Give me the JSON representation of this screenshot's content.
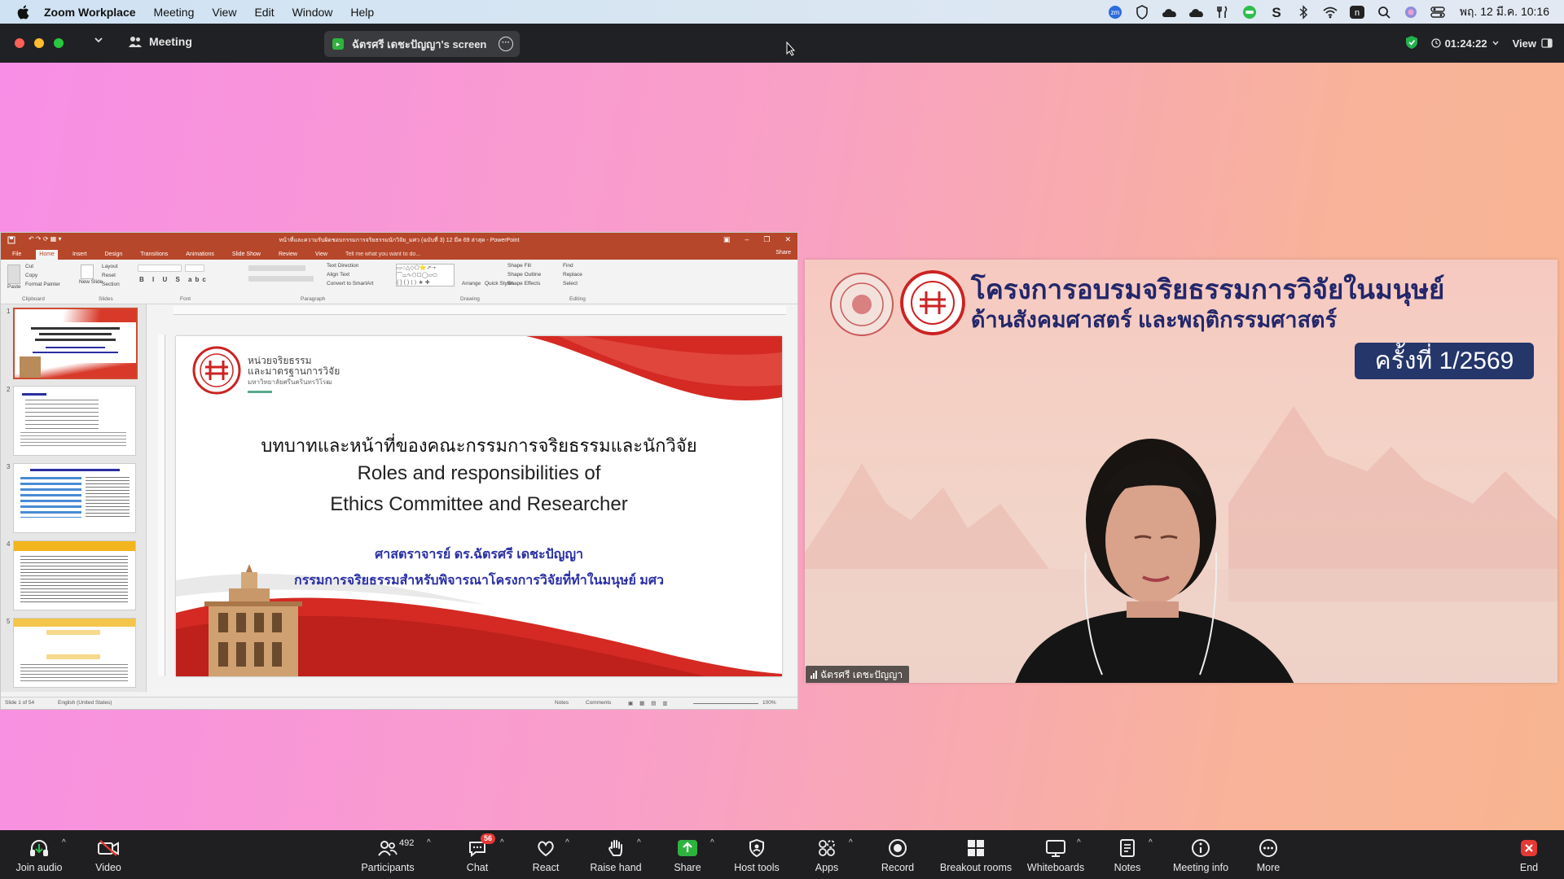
{
  "menubar": {
    "app_name": "Zoom Workplace",
    "menus": [
      "Meeting",
      "View",
      "Edit",
      "Window",
      "Help"
    ],
    "clock": "พฤ. 12 มี.ค.  10:16"
  },
  "zoom_header": {
    "meeting_label": "Meeting",
    "shared_screen_label": "ฉัตรศรี เดชะปัญญา's screen",
    "timer": "01:24:22",
    "view_label": "View"
  },
  "powerpoint": {
    "window_title": "หน้าที่และความรับผิดชอบกรรมการจริยธรรมนักวิจัย_มศว (ฉบับที่ 3) 12 มีค 69 ล่าสุด - PowerPoint",
    "tabs": [
      "File",
      "Home",
      "Insert",
      "Design",
      "Transitions",
      "Animations",
      "Slide Show",
      "Review",
      "View"
    ],
    "active_tab": "Home",
    "tell_me": "Tell me what you want to do...",
    "share_label": "Share",
    "ribbon_groups": [
      "Clipboard",
      "Slides",
      "Font",
      "Paragraph",
      "Drawing",
      "Editing"
    ],
    "ribbon_items": {
      "cut": "Cut",
      "copy": "Copy",
      "format_painter": "Format Painter",
      "paste": "Paste",
      "new_slide": "New Slide",
      "layout": "Layout",
      "reset": "Reset",
      "section": "Section",
      "text_direction": "Text Direction",
      "align_text": "Align Text",
      "convert_smartart": "Convert to SmartArt",
      "arrange": "Arrange",
      "quick_styles": "Quick Styles",
      "shape_fill": "Shape Fill",
      "shape_outline": "Shape Outline",
      "shape_effects": "Shape Effects",
      "find": "Find",
      "replace": "Replace",
      "select": "Select"
    },
    "thumbnail_numbers": [
      "1",
      "2",
      "3",
      "4",
      "5"
    ],
    "slide": {
      "logo_line1": "หน่วยจริยธรรม",
      "logo_line2": "และมาตรฐานการวิจัย",
      "logo_line3": "มหาวิทยาลัยศรีนครินทรวิโรฒ",
      "heading_thai": "บทบาทและหน้าที่ของคณะกรรมการจริยธรรมและนักวิจัย",
      "heading_en1": "Roles and responsibilities of",
      "heading_en2": "Ethics Committee and Researcher",
      "presenter": "ศาสตราจารย์ ดร.ฉัตรศรี เดชะปัญญา",
      "presenter_role": "กรรมการจริยธรรมสำหรับพิจารณาโครงการวิจัยที่ทำในมนุษย์ มศว"
    },
    "status": {
      "slide_count": "Slide 1 of 54",
      "language": "English (United States)",
      "notes": "Notes",
      "comments": "Comments",
      "zoom": "100%"
    }
  },
  "video": {
    "banner_line1": "โครงการอบรมจริยธรรมการวิจัยในมนุษย์",
    "banner_line2": "ด้านสังคมศาสตร์ และพฤติกรรมศาสตร์",
    "session_badge": "ครั้งที่ 1/2569",
    "participant_name": "ฉัตรศรี เดชะปัญญา"
  },
  "toolbar": {
    "join_audio": "Join audio",
    "video": "Video",
    "participants": "Participants",
    "participant_count": "492",
    "chat": "Chat",
    "chat_badge": "56",
    "react": "React",
    "raise_hand": "Raise hand",
    "share": "Share",
    "host_tools": "Host tools",
    "apps": "Apps",
    "record": "Record",
    "breakout_rooms": "Breakout rooms",
    "whiteboards": "Whiteboards",
    "notes": "Notes",
    "meeting_info": "Meeting info",
    "more": "More",
    "end": "End"
  },
  "colors": {
    "ppt_red": "#b7472a",
    "zoom_dark": "#202124",
    "banner_navy": "#22276b",
    "share_green": "#2eb33f",
    "end_red": "#e53935"
  }
}
